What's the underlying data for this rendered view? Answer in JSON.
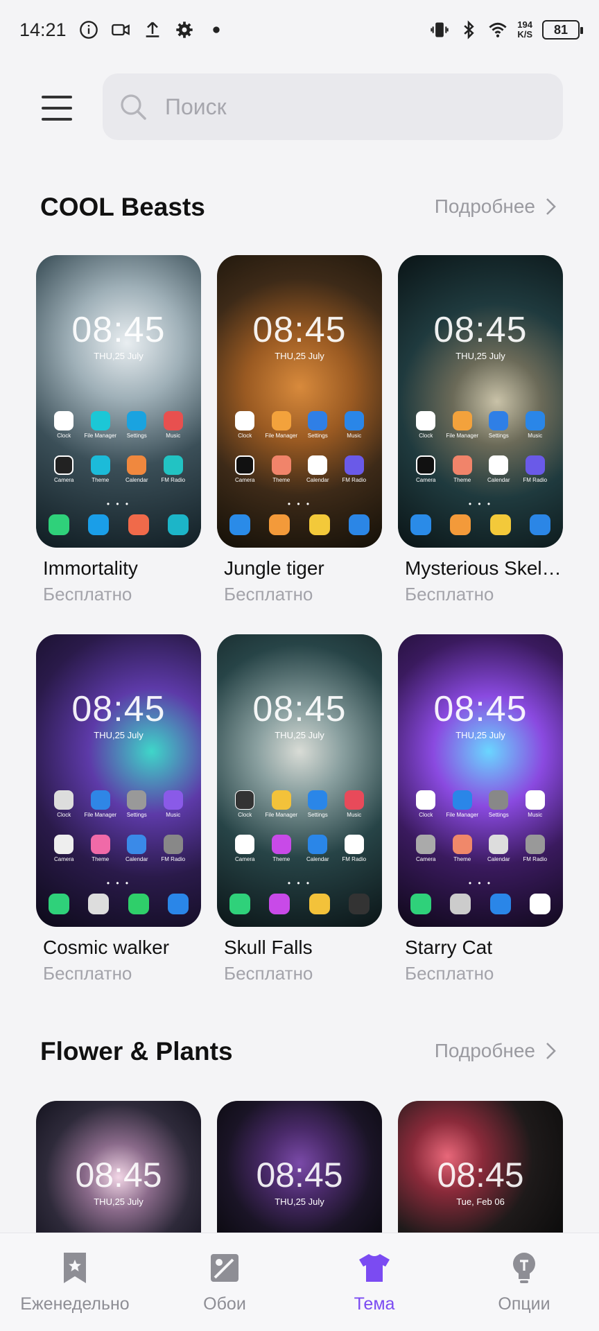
{
  "status_bar": {
    "time": "14:21",
    "net_speed_value": "194",
    "net_speed_unit": "K/S",
    "battery": "81"
  },
  "search": {
    "placeholder": "Поиск"
  },
  "sections": [
    {
      "title": "COOL Beasts",
      "more_label": "Подробнее",
      "themes": [
        {
          "name": "Immortality",
          "price": "Бесплатно"
        },
        {
          "name": "Jungle tiger",
          "price": "Бесплатно"
        },
        {
          "name": "Mysterious Skel…",
          "price": "Бесплатно"
        },
        {
          "name": "Cosmic walker",
          "price": "Бесплатно"
        },
        {
          "name": "Skull Falls",
          "price": "Бесплатно"
        },
        {
          "name": "Starry Cat",
          "price": "Бесплатно"
        }
      ]
    },
    {
      "title": "Flower & Plants",
      "more_label": "Подробнее"
    }
  ],
  "preview": {
    "time": "08:45",
    "date": "THU,25 July",
    "alt_date": "Tue, Feb 06",
    "app_labels": [
      "Clock",
      "File Manager",
      "Settings",
      "Music",
      "Camera",
      "Theme",
      "Calendar",
      "FM Radio"
    ]
  },
  "bottom_nav": [
    {
      "label": "Еженедельно",
      "icon": "bookmark-star-icon"
    },
    {
      "label": "Обои",
      "icon": "wallpaper-icon"
    },
    {
      "label": "Тема",
      "icon": "tshirt-icon",
      "active": true
    },
    {
      "label": "Опции",
      "icon": "lightbulb-icon"
    }
  ],
  "colors": {
    "accent": "#7b4bf2",
    "muted": "#a3a3aa",
    "background": "#f4f4f6"
  }
}
